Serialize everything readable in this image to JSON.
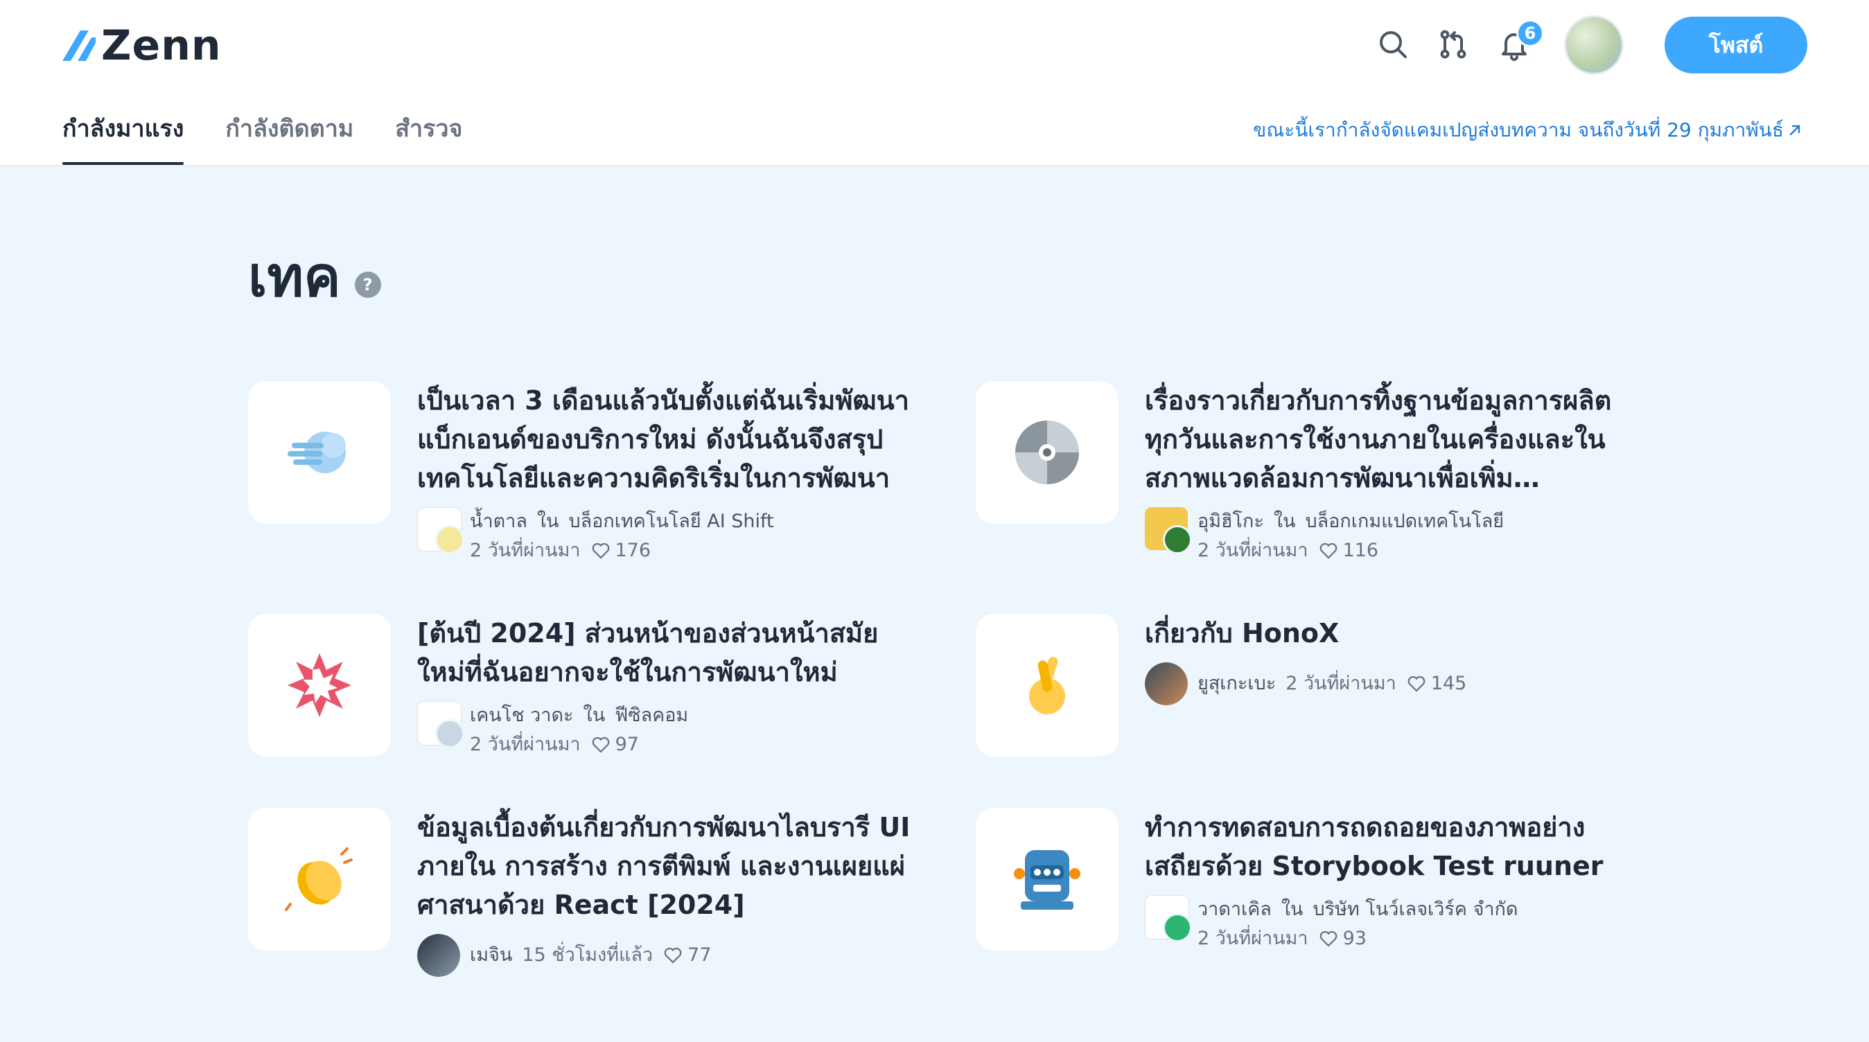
{
  "header": {
    "logo_text": "Zenn",
    "notification_count": "6",
    "post_button": "โพสต์",
    "tabs": [
      "กำลังมาแรง",
      "กำลังติดตาม",
      "สำรวจ"
    ],
    "campaign_link": "ขณะนี้เรากำลังจัดแคมเปญส่งบทความ จนถึงวันที่ 29 กุมภาพันธ์"
  },
  "section": {
    "title": "เทค",
    "help": "?"
  },
  "articles": [
    {
      "title": "เป็นเวลา 3 เดือนแล้วนับตั้งแต่ฉันเริ่มพัฒนาแบ็กเอนด์ของบริการใหม่ ดังนั้นฉันจึงสรุปเทคโนโลยีและความคิดริเริ่มในการพัฒนา",
      "author": "น้ำตาล",
      "in": "ใน",
      "publication": "บล็อกเทคโนโลยี AI Shift",
      "time": "2 วันที่ผ่านมา",
      "likes": "176",
      "emoji": "dash"
    },
    {
      "title": "เรื่องราวเกี่ยวกับการทิ้งฐานข้อมูลการผลิตทุกวันและการใช้งานภายในเครื่องและในสภาพแวดล้อมการพัฒนาเพื่อเพิ่มประสิทธิภาพ",
      "author": "อุมิฮิโกะ",
      "in": "ใน",
      "publication": "บล็อกเกมแปดเทคโนโลยี",
      "time": "2 วันที่ผ่านมา",
      "likes": "116",
      "emoji": "cd"
    },
    {
      "title": "[ต้นปี 2024] ส่วนหน้าของส่วนหน้าสมัยใหม่ที่ฉันอยากจะใช้ในการพัฒนาใหม่",
      "author": "เคนโช วาดะ",
      "in": "ใน",
      "publication": "ฟีซิลคอม",
      "time": "2 วันที่ผ่านมา",
      "likes": "97",
      "emoji": "star"
    },
    {
      "title": "เกี่ยวกับ HonoX",
      "author": "ยูสุเกะเบะ",
      "in": "",
      "publication": "",
      "time": "2 วันที่ผ่านมา",
      "likes": "145",
      "emoji": "fingers"
    },
    {
      "title": "ข้อมูลเบื้องต้นเกี่ยวกับการพัฒนาไลบรารี UI ภายใน การสร้าง การตีพิมพ์ และงานเผยแผ่ศาสนาด้วย React [2024]",
      "author": "เมจิน",
      "in": "",
      "publication": "",
      "time": "15 ชั่วโมงที่แล้ว",
      "likes": "77",
      "emoji": "clap"
    },
    {
      "title": "ทำการทดสอบการถดถอยของภาพอย่างเสถียรด้วย Storybook Test ruuner",
      "author": "วาดาเคิล",
      "in": "ใน",
      "publication": "บริษัท โนว์เลจเวิร์ค จำกัด",
      "time": "2 วันที่ผ่านมา",
      "likes": "93",
      "emoji": "robot"
    }
  ],
  "colors": {
    "accent": "#3ea8ff",
    "background": "#edf5fd",
    "link": "#1d7bd8"
  }
}
